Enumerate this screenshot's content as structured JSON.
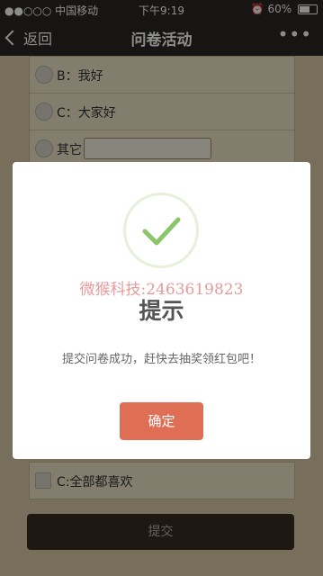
{
  "status_bar": {
    "carrier": "●●○○○ 中国移动",
    "time": "下午9:19",
    "battery": "60%",
    "battery_level": 0.6
  },
  "nav": {
    "back_label": "返回",
    "title": "问卷活动",
    "more_label": "•••"
  },
  "question1": {
    "options": [
      {
        "label": "B：我好"
      },
      {
        "label": "C：大家好"
      },
      {
        "label": "其它"
      }
    ]
  },
  "question2": {
    "options": [
      {
        "label": "C:全部都喜欢"
      }
    ]
  },
  "submit_label": "提交",
  "modal": {
    "watermark": "微猴科技:2463619823",
    "title": "提示",
    "message": "提交问卷成功，赶快去抽奖领红包吧！",
    "confirm_label": "确定"
  },
  "colors": {
    "confirm": "#de6f55",
    "check": "#8cc66a",
    "nav": "#2a2725"
  }
}
